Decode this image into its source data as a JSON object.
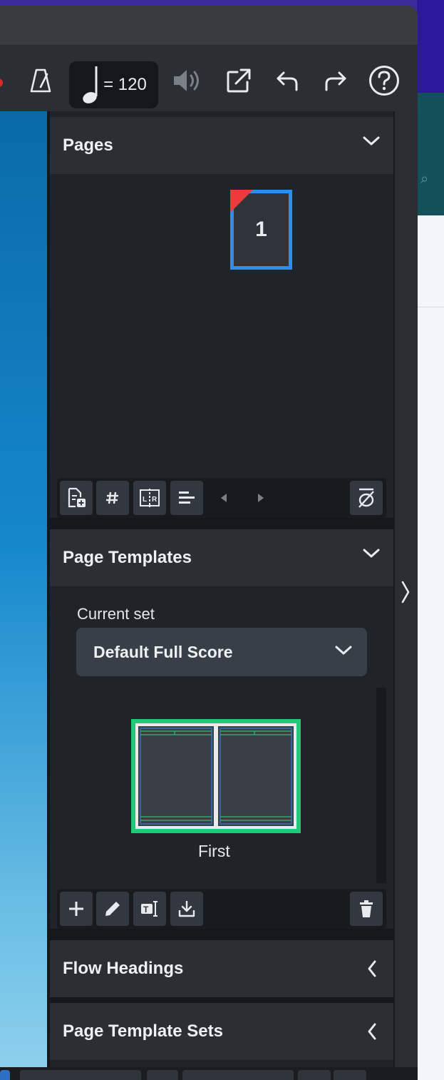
{
  "toolbar": {
    "tempo_value": "= 120",
    "icons": [
      "metronome-icon",
      "quarter-note-icon",
      "speaker-icon",
      "export-icon",
      "undo-icon",
      "redo-icon",
      "help-icon"
    ]
  },
  "pages_panel": {
    "title": "Pages",
    "page_number": "1",
    "buttons": [
      "insert-page-icon",
      "page-numbering-icon",
      "page-spread-icon",
      "align-icon",
      "previous-icon",
      "next-icon",
      "clear-override-icon"
    ]
  },
  "page_templates_panel": {
    "title": "Page Templates",
    "current_set_label": "Current set",
    "current_set_value": "Default Full Score",
    "template_name": "First",
    "buttons": [
      "add-icon",
      "edit-icon",
      "rename-icon",
      "import-icon",
      "delete-icon"
    ]
  },
  "flow_headings_panel": {
    "title": "Flow Headings"
  },
  "page_template_sets_panel": {
    "title": "Page Template Sets"
  },
  "colors": {
    "selection_blue": "#2d8ef0",
    "template_green": "#1ec97a",
    "override_red": "#ec3b3b",
    "panel_bg": "#202327",
    "header_bg": "#2b2f34"
  }
}
